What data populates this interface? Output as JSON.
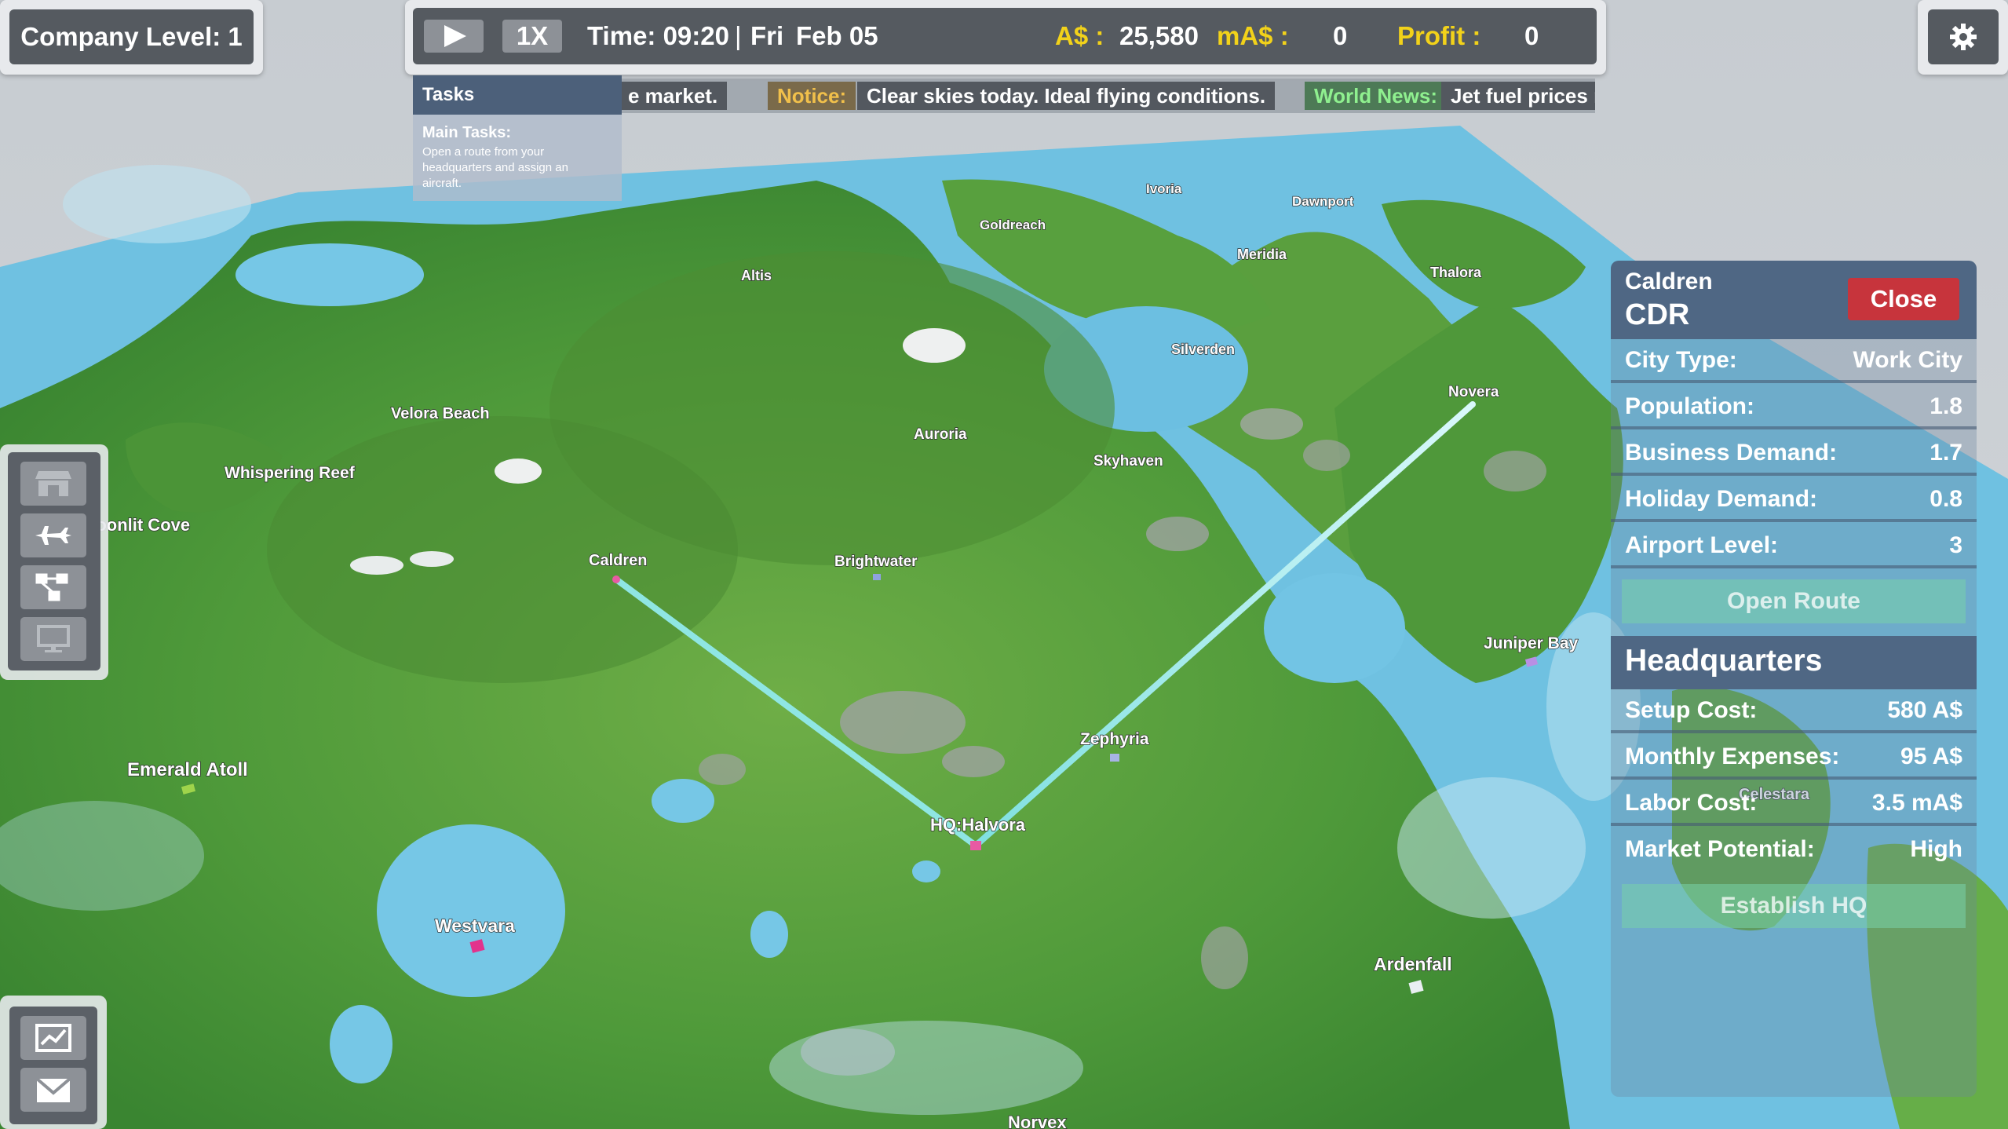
{
  "company": {
    "level_label": "Company Level: 1"
  },
  "topbar": {
    "speed": "1X",
    "time": "Time: 09:20",
    "day": "Fri",
    "date": "Feb  05",
    "currency_label": "A$ :",
    "currency_value": "25,580",
    "macurrency_label": "mA$ :",
    "macurrency_value": "0",
    "profit_label": "Profit :",
    "profit_value": "0"
  },
  "news": {
    "ticker_tail": "e market.",
    "notice_label": "Notice:",
    "notice_text": "Clear skies today. Ideal flying conditions.",
    "world_label": "World News:",
    "world_text": "Jet fuel prices r"
  },
  "tasks": {
    "title": "Tasks",
    "subtitle": "Main Tasks:",
    "description": "Open a route from your headquarters and assign an aircraft."
  },
  "map": {
    "cities": [
      "Ivoria",
      "Dawnport",
      "Goldreach",
      "Meridia",
      "Thalora",
      "Altis",
      "Silverden",
      "Novera",
      "Velora Beach",
      "Auroria",
      "Skyhaven",
      "Whispering Reef",
      "Moonlit Cove",
      "Caldren",
      "Brightwater",
      "Juniper Bay",
      "Zephyria",
      "Emerald Atoll",
      "HQ:Halvora",
      "Celestara",
      "Westvara",
      "Ardenfall",
      "Norvex"
    ]
  },
  "city_panel": {
    "name": "Caldren",
    "code": "CDR",
    "close_label": "Close",
    "rows": [
      {
        "label": "City Type:",
        "value": "Work City"
      },
      {
        "label": "Population:",
        "value": "1.8"
      },
      {
        "label": "Business Demand:",
        "value": "1.7"
      },
      {
        "label": "Holiday Demand:",
        "value": "0.8"
      },
      {
        "label": "Airport Level:",
        "value": "3"
      }
    ],
    "open_route_label": "Open Route"
  },
  "hq_panel": {
    "title": "Headquarters",
    "rows": [
      {
        "label": "Setup Cost:",
        "value": "580 A$"
      },
      {
        "label": "Monthly Expenses:",
        "value": "95 A$"
      },
      {
        "label": "Labor Cost:",
        "value": "3.5 mA$"
      },
      {
        "label": "Market Potential:",
        "value": "High"
      }
    ],
    "establish_label": "Establish HQ"
  },
  "icons": {
    "toolbar": [
      "store-icon",
      "airplane-icon",
      "route-network-icon",
      "monitor-icon"
    ],
    "bottom": [
      "chart-icon",
      "mail-icon"
    ],
    "settings": "gear-icon"
  }
}
